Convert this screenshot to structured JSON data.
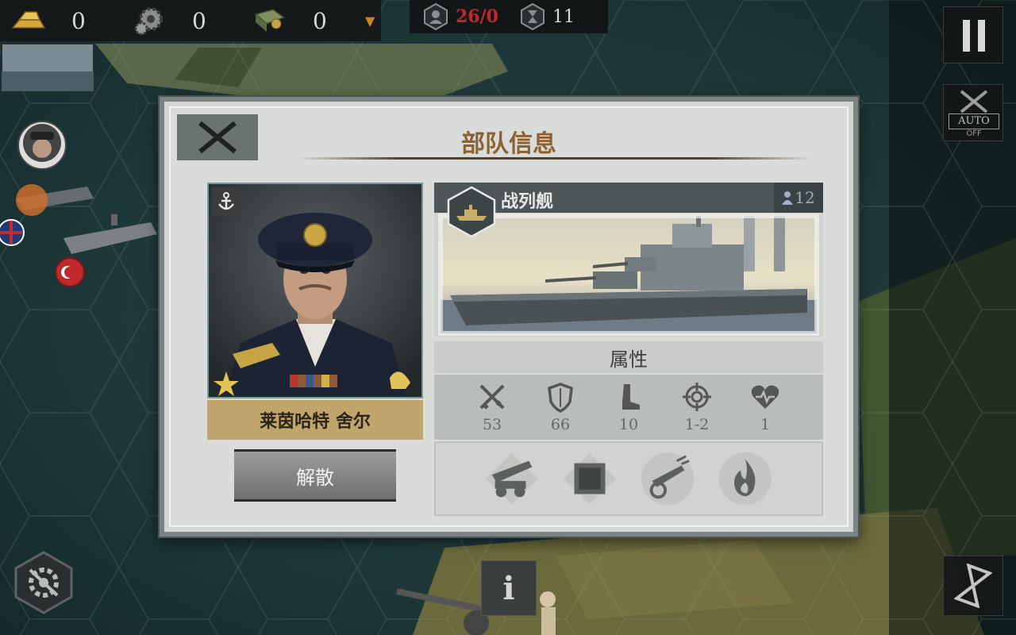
{
  "resources": [
    {
      "icon": "gold-bars-icon",
      "value": "0"
    },
    {
      "icon": "industry-gear-icon",
      "value": "0"
    },
    {
      "icon": "tech-book-icon",
      "value": "0"
    }
  ],
  "status": {
    "units_label": "26/0",
    "turns_label": "11"
  },
  "buttons": {
    "auto_label": "AUTO",
    "auto_state": "OFF",
    "info_label": "i"
  },
  "dialog": {
    "title": "部队信息",
    "commander_name": "莱茵哈特 舍尔",
    "disband_label": "解散",
    "unit_type": "战列舰",
    "unit_count": "12",
    "attributes_label": "属性",
    "stats": [
      {
        "icon": "attack-swords-icon",
        "value": "53"
      },
      {
        "icon": "defense-shield-icon",
        "value": "66"
      },
      {
        "icon": "movement-boot-icon",
        "value": "10"
      },
      {
        "icon": "range-crosshair-icon",
        "value": "1-2"
      },
      {
        "icon": "health-heart-icon",
        "value": "1"
      }
    ],
    "abilities": [
      "artillery-cannon-icon",
      "armor-plating-icon",
      "anti-air-gun-icon",
      "fire-icon"
    ]
  },
  "colors": {
    "title": "#8b6131",
    "name_plate": "#c0a66c",
    "alert_red": "#c0292b"
  }
}
